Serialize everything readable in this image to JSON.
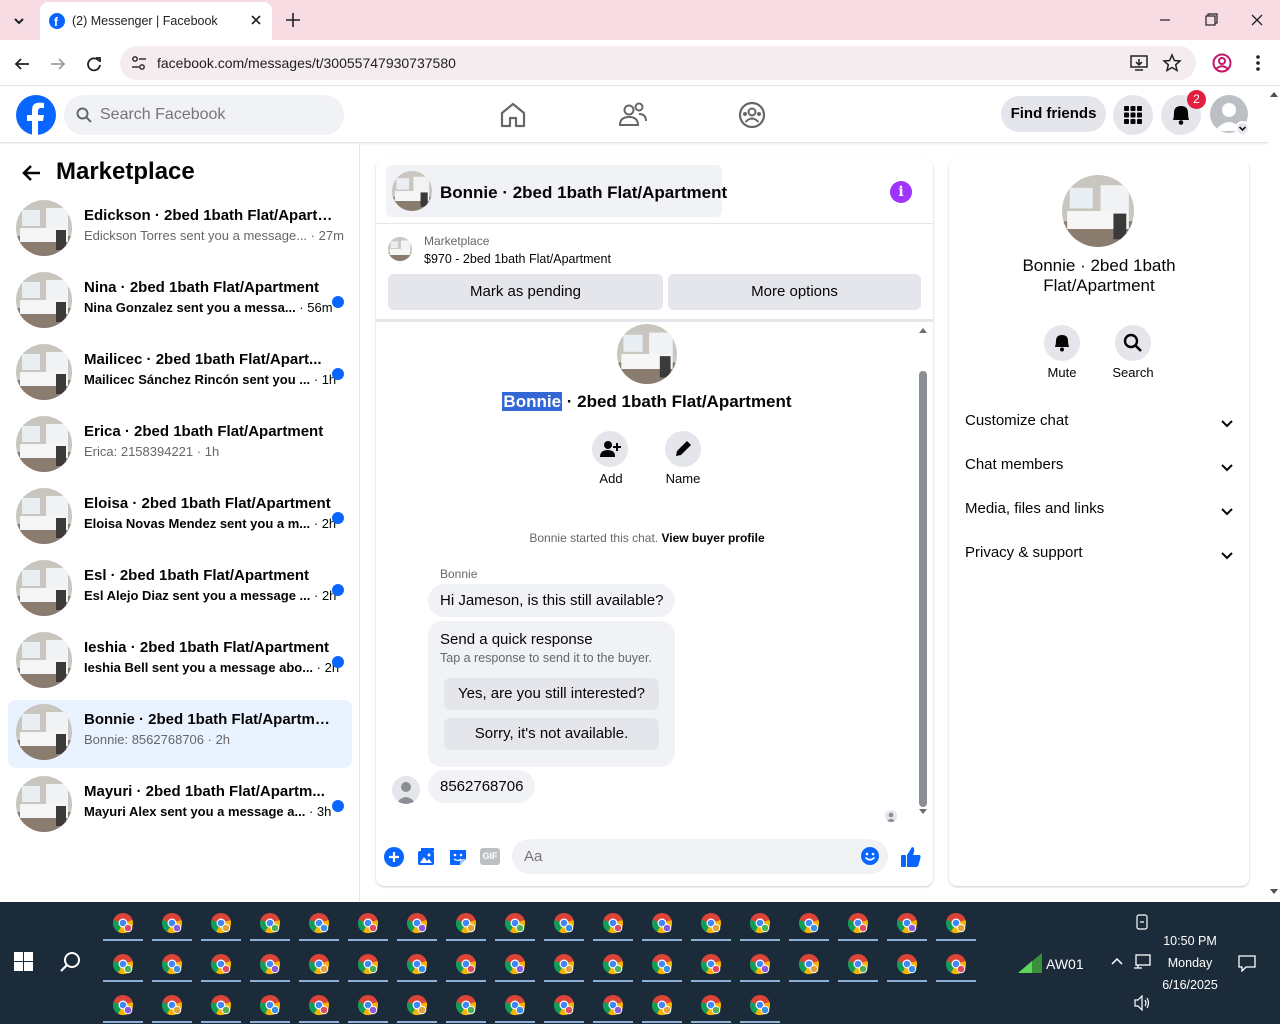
{
  "browser": {
    "tab_title": "(2) Messenger | Facebook",
    "url": "facebook.com/messages/t/30055747930737580"
  },
  "header": {
    "search_placeholder": "Search Facebook",
    "find_friends": "Find friends",
    "notification_count": "2"
  },
  "sidebar": {
    "title": "Marketplace",
    "conversations": [
      {
        "name": "Edickson · 2bed 1bath Flat/Apartm...",
        "preview": "Edickson Torres sent you a message...",
        "time": "27m",
        "unread": false
      },
      {
        "name": "Nina · 2bed 1bath Flat/Apartment",
        "preview": "Nina Gonzalez sent you a messa...",
        "time": "56m",
        "unread": true
      },
      {
        "name": "Mailicec · 2bed 1bath Flat/Apart...",
        "preview": "Mailicec Sánchez Rincón sent you ...",
        "time": "1h",
        "unread": true
      },
      {
        "name": "Erica · 2bed 1bath Flat/Apartment",
        "preview": "Erica: 2158394221",
        "time": "1h",
        "unread": false
      },
      {
        "name": "Eloisa · 2bed 1bath Flat/Apartment",
        "preview": "Eloisa Novas Mendez sent you a m...",
        "time": "2h",
        "unread": true
      },
      {
        "name": "Esl · 2bed 1bath Flat/Apartment",
        "preview": "Esl Alejo Diaz sent you a message ...",
        "time": "2h",
        "unread": true
      },
      {
        "name": "Ieshia · 2bed 1bath Flat/Apartment",
        "preview": "Ieshia Bell sent you a message abo...",
        "time": "2h",
        "unread": true
      },
      {
        "name": "Bonnie · 2bed 1bath Flat/Apartment",
        "preview": "Bonnie: 8562768706",
        "time": "2h",
        "unread": false,
        "selected": true
      },
      {
        "name": "Mayuri · 2bed 1bath Flat/Apartm...",
        "preview": "Mayuri Alex sent you a message a...",
        "time": "3h",
        "unread": true
      }
    ]
  },
  "chat": {
    "title": "Bonnie · 2bed 1bath Flat/Apartment",
    "marketplace_label": "Marketplace",
    "listing": "$970 - 2bed 1bath Flat/Apartment",
    "mark_pending": "Mark as pending",
    "more_options": "More options",
    "intro_name_highlight": "Bonnie",
    "intro_name_rest": " · 2bed 1bath Flat/Apartment",
    "add_label": "Add",
    "name_label": "Name",
    "started_text": "Bonnie started this chat.",
    "view_profile": "View buyer profile",
    "sender": "Bonnie",
    "msg1": "Hi Jameson, is this still available?",
    "quick_title": "Send a quick response",
    "quick_sub": "Tap a response to send it to the buyer.",
    "quick1": "Yes, are you still interested?",
    "quick2": "Sorry, it's not available.",
    "msg2": "8562768706",
    "composer_placeholder": "Aa",
    "gif_label": "GIF"
  },
  "details": {
    "name": "Bonnie · 2bed 1bath Flat/Apartment",
    "mute": "Mute",
    "search": "Search",
    "rows": [
      "Customize chat",
      "Chat members",
      "Media, files and links",
      "Privacy & support"
    ]
  },
  "taskbar": {
    "network_label": "AW01",
    "time": "10:50 PM",
    "day": "Monday",
    "date": "6/16/2025"
  }
}
